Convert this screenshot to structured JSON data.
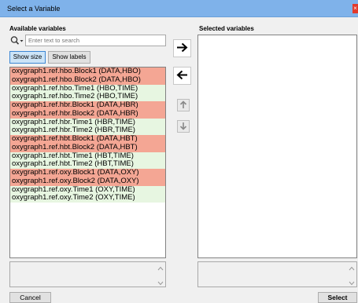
{
  "window": {
    "title": "Select a Variable",
    "close_label": "×"
  },
  "available": {
    "heading": "Available variables",
    "search_placeholder": "Enter text to search",
    "show_size_label": "Show size",
    "show_labels_label": "Show labels",
    "items": [
      {
        "label": "oxygraph1.ref.hbo.Block1 (DATA,HBO)",
        "kind": "data"
      },
      {
        "label": "oxygraph1.ref.hbo.Block2 (DATA,HBO)",
        "kind": "data"
      },
      {
        "label": "oxygraph1.ref.hbo.Time1 (HBO,TIME)",
        "kind": "time"
      },
      {
        "label": "oxygraph1.ref.hbo.Time2 (HBO,TIME)",
        "kind": "time"
      },
      {
        "label": "oxygraph1.ref.hbr.Block1 (DATA,HBR)",
        "kind": "data"
      },
      {
        "label": "oxygraph1.ref.hbr.Block2 (DATA,HBR)",
        "kind": "data"
      },
      {
        "label": "oxygraph1.ref.hbr.Time1 (HBR,TIME)",
        "kind": "time"
      },
      {
        "label": "oxygraph1.ref.hbr.Time2 (HBR,TIME)",
        "kind": "time"
      },
      {
        "label": "oxygraph1.ref.hbt.Block1 (DATA,HBT)",
        "kind": "data"
      },
      {
        "label": "oxygraph1.ref.hbt.Block2 (DATA,HBT)",
        "kind": "data"
      },
      {
        "label": "oxygraph1.ref.hbt.Time1 (HBT,TIME)",
        "kind": "time"
      },
      {
        "label": "oxygraph1.ref.hbt.Time2 (HBT,TIME)",
        "kind": "time"
      },
      {
        "label": "oxygraph1.ref.oxy.Block1 (DATA,OXY)",
        "kind": "data"
      },
      {
        "label": "oxygraph1.ref.oxy.Block2 (DATA,OXY)",
        "kind": "data"
      },
      {
        "label": "oxygraph1.ref.oxy.Time1 (OXY,TIME)",
        "kind": "time"
      },
      {
        "label": "oxygraph1.ref.oxy.Time2 (OXY,TIME)",
        "kind": "time"
      }
    ]
  },
  "selected": {
    "heading": "Selected variables"
  },
  "footer": {
    "cancel_label": "Cancel",
    "select_label": "Select"
  },
  "colors": {
    "data_row": "#f4a694",
    "time_row": "#e7f6e1",
    "titlebar": "#7fb2ea",
    "close": "#e23a2c"
  }
}
